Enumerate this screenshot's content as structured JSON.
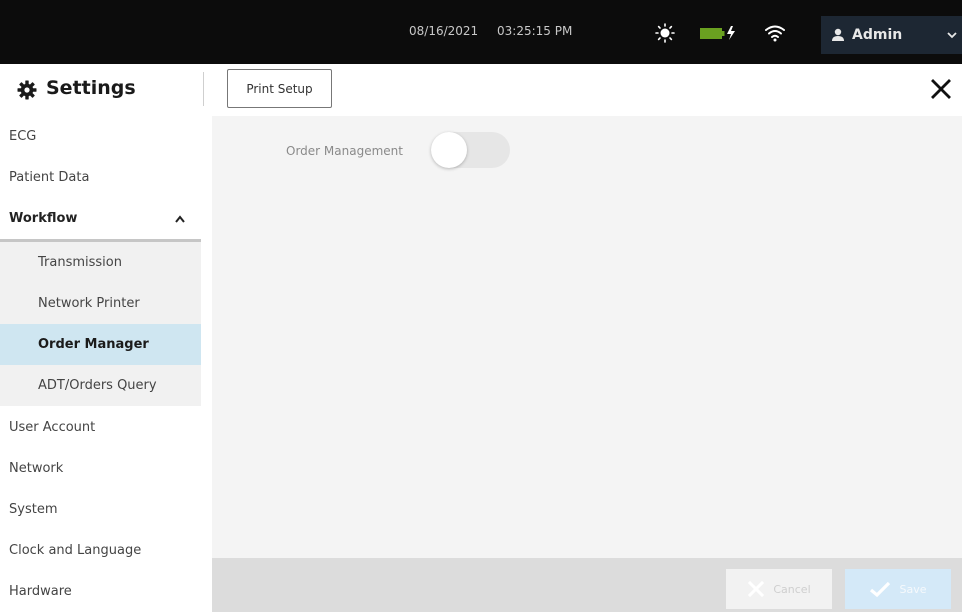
{
  "status_bar": {
    "date": "08/16/2021",
    "time": "03:25:15 PM",
    "icons": [
      "brightness-icon",
      "battery-charging-icon",
      "wifi-icon"
    ],
    "battery_color": "#6aa020",
    "user": {
      "name": "Admin",
      "icon": "user-icon",
      "menu_icon": "chevron-down-icon"
    }
  },
  "header": {
    "title": "Settings",
    "title_icon": "gear-icon",
    "tabs": [
      {
        "label": "Print Setup"
      }
    ],
    "close_icon": "close-icon"
  },
  "sidebar": {
    "items": [
      {
        "label": "ECG"
      },
      {
        "label": "Patient Data"
      },
      {
        "label": "Workflow",
        "expanded": true,
        "children": [
          {
            "label": "Transmission"
          },
          {
            "label": "Network Printer"
          },
          {
            "label": "Order Manager",
            "selected": true
          },
          {
            "label": "ADT/Orders Query"
          }
        ]
      },
      {
        "label": "User Account"
      },
      {
        "label": "Network"
      },
      {
        "label": "System"
      },
      {
        "label": "Clock and Language"
      },
      {
        "label": "Hardware"
      }
    ],
    "selected_color": "#cfe6f1"
  },
  "content": {
    "setting_label": "Order Management",
    "toggle_on": false
  },
  "footer": {
    "cancel_label": "Cancel",
    "save_label": "Save",
    "save_color": "#d4e9f8"
  }
}
